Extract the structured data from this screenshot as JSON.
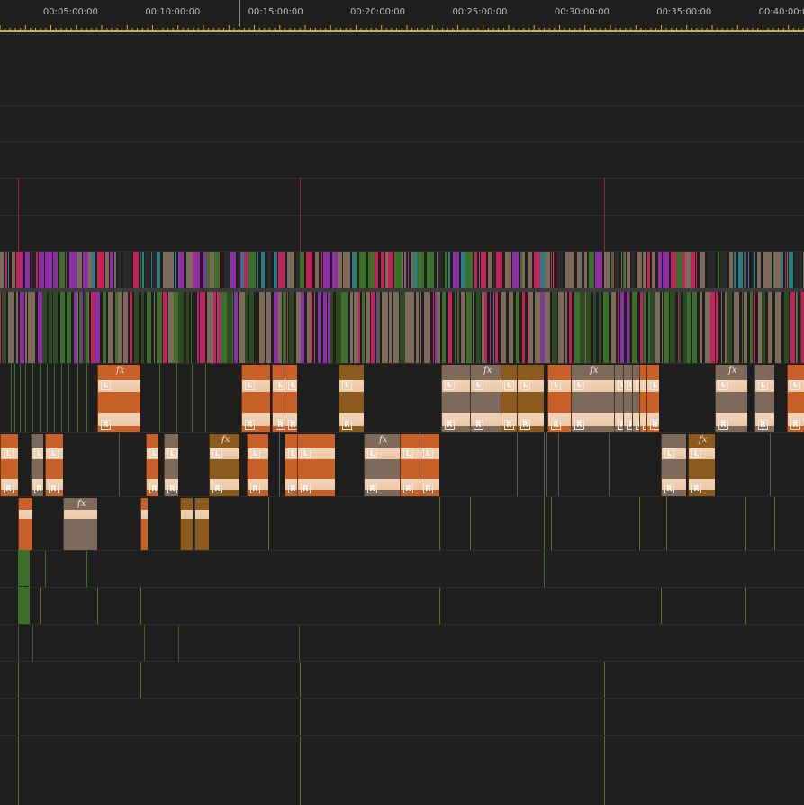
{
  "window": {
    "title": ""
  },
  "timeline": {
    "playhead_label": "",
    "timecodes": [
      {
        "text": "00:05:00:00",
        "pos": 0.085
      },
      {
        "text": "00:10:00:00",
        "pos": 0.212
      },
      {
        "text": "00:15:00:00",
        "pos": 0.34
      },
      {
        "text": "00:20:00:00",
        "pos": 0.467
      },
      {
        "text": "00:25:00:00",
        "pos": 0.594
      },
      {
        "text": "00:30:00:00",
        "pos": 0.721
      },
      {
        "text": "00:35:00:00",
        "pos": 0.848
      },
      {
        "text": "00:40:00:00",
        "pos": 0.975
      }
    ],
    "colors": {
      "background": "#1e1e1e",
      "ruler_ticks": "#c9b24a",
      "marker": "#a11f3c",
      "clip_orange": "#c8602a",
      "clip_tan": "#7d6a5a",
      "clip_brown": "#8a5a1e",
      "clip_violet": "#8e2fa6",
      "clip_green": "#3b6f2a",
      "clip_magenta": "#c0245a",
      "clip_teal": "#2a7c86"
    },
    "audio_labels": {
      "left": "L",
      "right": "R",
      "effect": "fx"
    },
    "icons": [
      "keyframe-icon",
      "fx-badge-icon",
      "playhead-icon"
    ]
  }
}
